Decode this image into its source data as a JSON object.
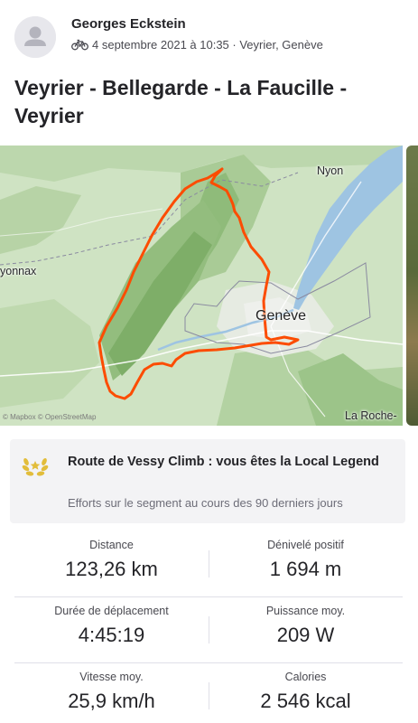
{
  "activity": {
    "athlete_name": "Georges Eckstein",
    "sport_icon": "bike-icon",
    "date_location": "4 septembre 2021 à 10:35 · Veyrier, Genève",
    "title": "Veyrier - Bellegarde - La Faucille - Veyrier"
  },
  "map": {
    "labels": {
      "nyon": "Nyon",
      "oyonnax": "yonnax",
      "geneve": "Genève",
      "la_roche": "La Roche-"
    },
    "attribution": "© Mapbox © OpenStreetMap",
    "route_color": "#fc4c02"
  },
  "achievement": {
    "icon": "laurel-icon",
    "title": "Route de Vessy Climb : vous êtes la Local Legend",
    "subtitle": "Efforts sur le segment au cours des 90 derniers jours"
  },
  "stats": [
    {
      "label": "Distance",
      "value": "123,26 km"
    },
    {
      "label": "Dénivelé positif",
      "value": "1 694 m"
    },
    {
      "label": "Durée de déplacement",
      "value": "4:45:19"
    },
    {
      "label": "Puissance moy.",
      "value": "209 W"
    },
    {
      "label": "Vitesse moy.",
      "value": "25,9 km/h"
    },
    {
      "label": "Calories",
      "value": "2 546 kcal"
    }
  ]
}
